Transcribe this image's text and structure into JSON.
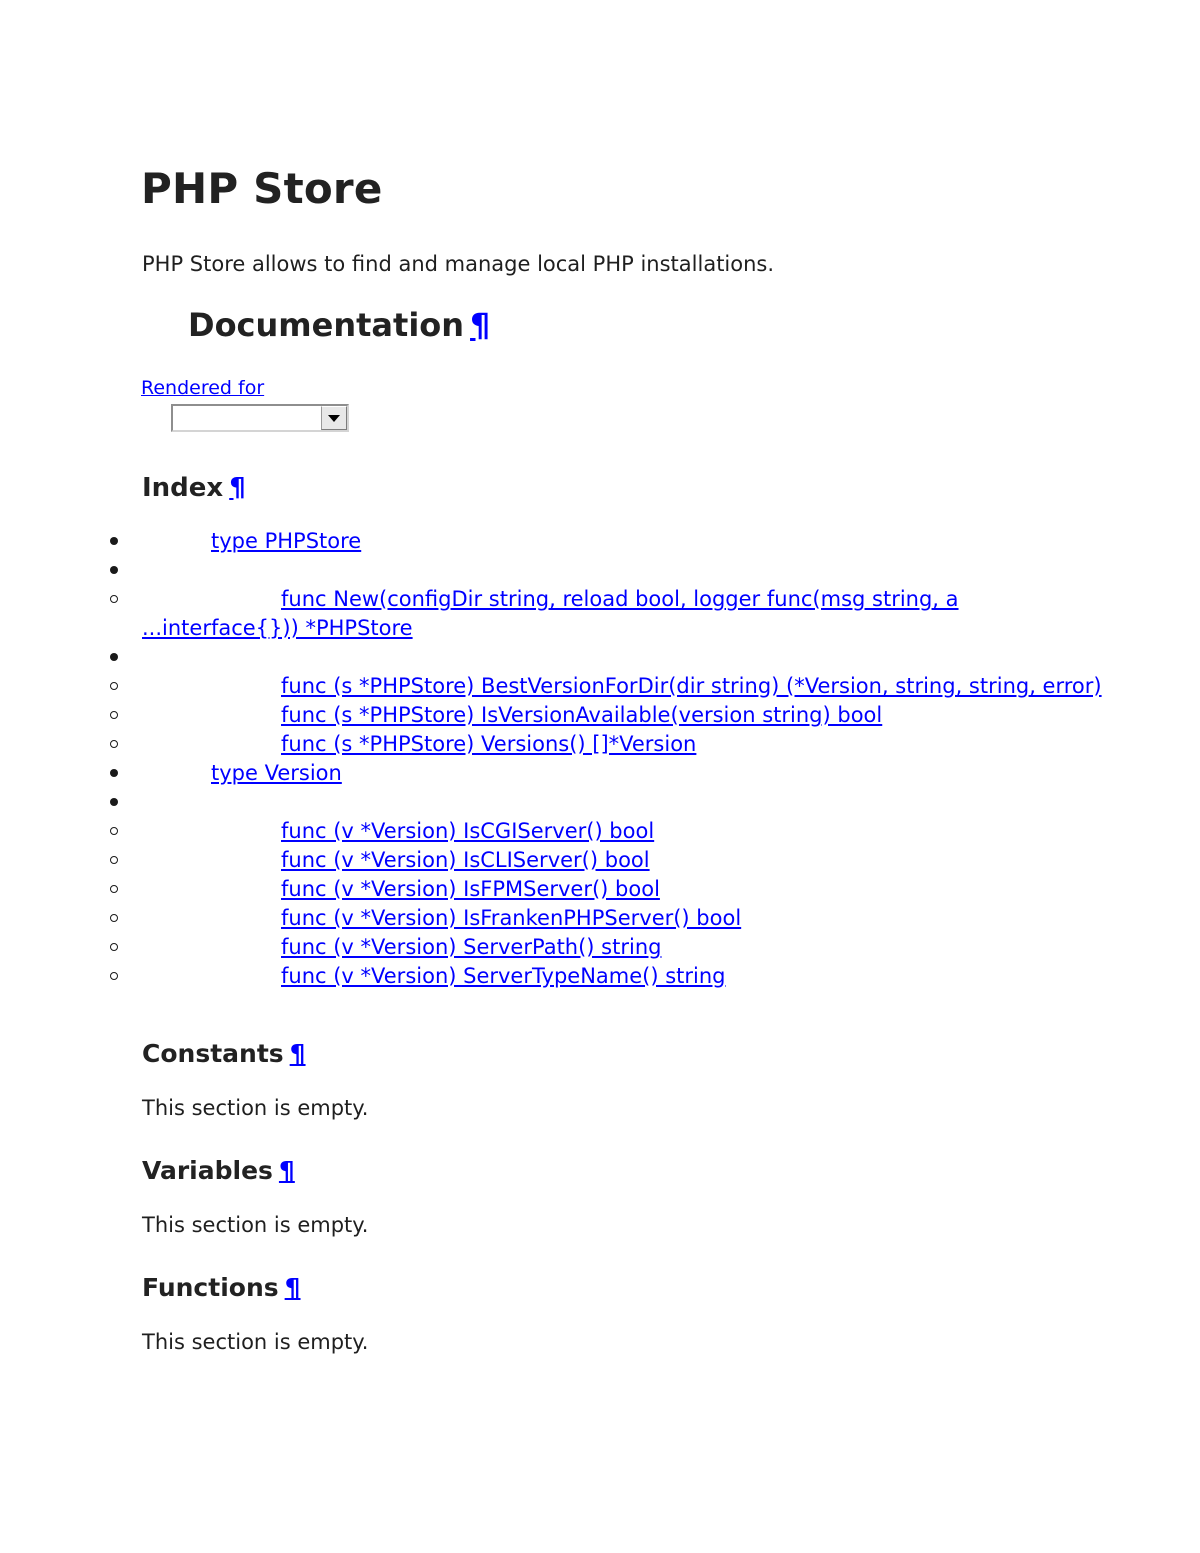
{
  "page": {
    "title": "PHP Store",
    "intro": "PHP Store allows to find and manage local PHP installations.",
    "pilcrow": "¶"
  },
  "documentation": {
    "heading": "Documentation",
    "rendered_for": {
      "label": "Rendered for",
      "selected_value": "",
      "placeholder": ""
    }
  },
  "index": {
    "heading": "Index",
    "items": [
      {
        "marker": "disc",
        "kind": "type",
        "label": "type PHPStore"
      },
      {
        "marker": "disc",
        "kind": "blank",
        "label": ""
      },
      {
        "marker": "circle",
        "kind": "func",
        "label": "func New(configDir string, reload bool, logger func(msg string, a ...interface{})) *PHPStore"
      },
      {
        "marker": "disc",
        "kind": "blank",
        "label": ""
      },
      {
        "marker": "circle",
        "kind": "func",
        "label": "func (s *PHPStore) BestVersionForDir(dir string) (*Version, string, string, error)"
      },
      {
        "marker": "circle",
        "kind": "func",
        "label": "func (s *PHPStore) IsVersionAvailable(version string) bool"
      },
      {
        "marker": "circle",
        "kind": "func",
        "label": "func (s *PHPStore) Versions() []*Version"
      },
      {
        "marker": "disc",
        "kind": "type",
        "label": "type Version"
      },
      {
        "marker": "disc",
        "kind": "blank",
        "label": ""
      },
      {
        "marker": "circle",
        "kind": "func",
        "label": "func (v *Version) IsCGIServer() bool"
      },
      {
        "marker": "circle",
        "kind": "func",
        "label": "func (v *Version) IsCLIServer() bool"
      },
      {
        "marker": "circle",
        "kind": "func",
        "label": "func (v *Version) IsFPMServer() bool"
      },
      {
        "marker": "circle",
        "kind": "func",
        "label": "func (v *Version) IsFrankenPHPServer() bool"
      },
      {
        "marker": "circle",
        "kind": "func",
        "label": "func (v *Version) ServerPath() string"
      },
      {
        "marker": "circle",
        "kind": "func",
        "label": "func (v *Version) ServerTypeName() string"
      }
    ]
  },
  "sections": [
    {
      "heading": "Constants",
      "note": "This section is empty."
    },
    {
      "heading": "Variables",
      "note": "This section is empty."
    },
    {
      "heading": "Functions",
      "note": "This section is empty."
    }
  ],
  "colors": {
    "link": "#0000FF",
    "heading": "#222222",
    "text": "#1F1F1F",
    "background": "#FFFFFF"
  }
}
